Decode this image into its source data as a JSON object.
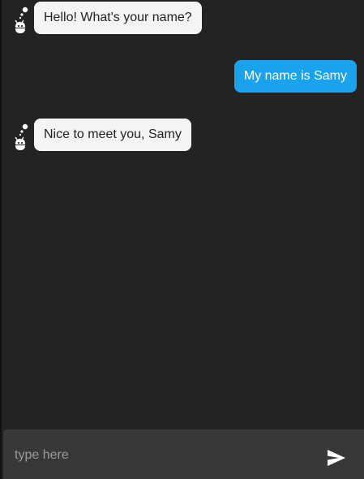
{
  "conversation": {
    "messages": [
      {
        "sender": "bot",
        "text": "Hello! What's your name?"
      },
      {
        "sender": "user",
        "text": "My name is Samy"
      },
      {
        "sender": "bot",
        "text": "Nice to meet you, Samy"
      }
    ]
  },
  "composer": {
    "placeholder": "type here",
    "value": "",
    "send_icon": "send-icon"
  },
  "colors": {
    "background": "#232323",
    "bot_bubble": "#f4f4f4",
    "user_bubble": "#1aa3ec",
    "composer": "#383838"
  },
  "icons": {
    "bot_avatar": "robot-icon"
  }
}
